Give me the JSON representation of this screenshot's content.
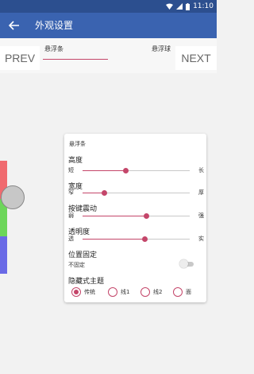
{
  "status_bar": {
    "time": "11:10"
  },
  "app_bar": {
    "title": "外观设置"
  },
  "nav": {
    "prev": "PREV",
    "next": "NEXT"
  },
  "tabs": [
    {
      "label": "悬浮条"
    },
    {
      "label": "悬浮球"
    }
  ],
  "card": {
    "title": "悬浮条",
    "sliders": [
      {
        "label": "高度",
        "min_label": "短",
        "max_label": "长",
        "value_fraction": 0.4
      },
      {
        "label": "宽度",
        "min_label": "窄",
        "max_label": "厚",
        "value_fraction": 0.2
      },
      {
        "label": "按键震动",
        "min_label": "弱",
        "max_label": "强",
        "value_fraction": 0.59
      },
      {
        "label": "透明度",
        "min_label": "透",
        "max_label": "实",
        "value_fraction": 0.58
      }
    ],
    "position_fixed": {
      "label": "位置固定",
      "sub_label": "不固定",
      "enabled": false
    },
    "theme": {
      "label": "隐藏式主题",
      "options": [
        {
          "label": "传统",
          "selected": true
        },
        {
          "label": "线1",
          "selected": false
        },
        {
          "label": "线2",
          "selected": false
        },
        {
          "label": "面",
          "selected": false
        }
      ]
    }
  },
  "colors": {
    "accent": "#c4466a",
    "app_bar": "#3a63b0",
    "status_bar": "#2c4f8f",
    "strip_red": "#f06a6f",
    "strip_green": "#6cd65a",
    "strip_blue": "#6a6ae6"
  }
}
